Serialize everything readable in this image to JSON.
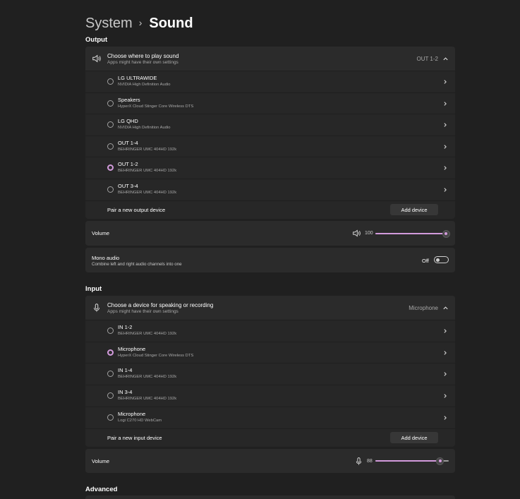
{
  "breadcrumb": {
    "parent": "System",
    "separator": "›",
    "current": "Sound"
  },
  "output": {
    "section_title": "Output",
    "header": {
      "title": "Choose where to play sound",
      "subtitle": "Apps might have their own settings",
      "value": "OUT 1-2"
    },
    "devices": [
      {
        "name": "LG ULTRAWIDE",
        "sub": "NVIDIA High Definition Audio",
        "selected": false
      },
      {
        "name": "Speakers",
        "sub": "HyperX Cloud Stinger Core Wireless DTS",
        "selected": false
      },
      {
        "name": "LG QHD",
        "sub": "NVIDIA High Definition Audio",
        "selected": false
      },
      {
        "name": "OUT 1-4",
        "sub": "BEHRINGER UMC 404HD 192k",
        "selected": false
      },
      {
        "name": "OUT 1-2",
        "sub": "BEHRINGER UMC 404HD 192k",
        "selected": true
      },
      {
        "name": "OUT 3-4",
        "sub": "BEHRINGER UMC 404HD 192k",
        "selected": false
      }
    ],
    "pair_label": "Pair a new output device",
    "add_button": "Add device",
    "volume": {
      "label": "Volume",
      "value_text": "100",
      "level": 1.0
    },
    "mono": {
      "title": "Mono audio",
      "subtitle": "Combine left and right audio channels into one",
      "state_text": "Off",
      "on": false
    }
  },
  "input": {
    "section_title": "Input",
    "header": {
      "title": "Choose a device for speaking or recording",
      "subtitle": "Apps might have their own settings",
      "value": "Microphone"
    },
    "devices": [
      {
        "name": "IN 1-2",
        "sub": "BEHRINGER UMC 404HD 192k",
        "selected": false
      },
      {
        "name": "Microphone",
        "sub": "HyperX Cloud Stinger Core Wireless DTS",
        "selected": true
      },
      {
        "name": "IN 1-4",
        "sub": "BEHRINGER UMC 404HD 192k",
        "selected": false
      },
      {
        "name": "IN 3-4",
        "sub": "BEHRINGER UMC 404HD 192k",
        "selected": false
      },
      {
        "name": "Microphone",
        "sub": "Logi C270 HD WebCam",
        "selected": false
      }
    ],
    "pair_label": "Pair a new input device",
    "add_button": "Add device",
    "volume": {
      "label": "Volume",
      "value_text": "88",
      "level": 0.88
    }
  },
  "advanced": {
    "section_title": "Advanced"
  },
  "colors": {
    "accent": "#d39bdc",
    "background": "#202020",
    "card": "#2b2b2b"
  },
  "icons": {
    "output_header": "speaker-icon",
    "input_header": "microphone-icon",
    "chevron_up": "chevron-up-icon",
    "chevron_right": "chevron-right-icon",
    "volume_output": "speaker-icon",
    "volume_input": "microphone-icon"
  }
}
